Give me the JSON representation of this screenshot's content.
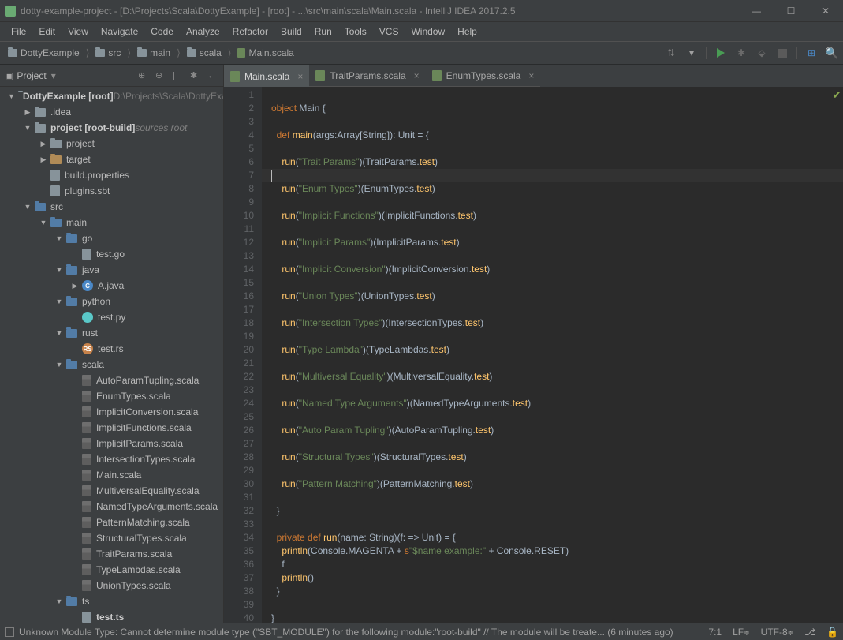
{
  "titlebar": {
    "title": "dotty-example-project - [D:\\Projects\\Scala\\DottyExample] - [root] - ...\\src\\main\\scala\\Main.scala - IntelliJ IDEA 2017.2.5"
  },
  "menu": [
    "File",
    "Edit",
    "View",
    "Navigate",
    "Code",
    "Analyze",
    "Refactor",
    "Build",
    "Run",
    "Tools",
    "VCS",
    "Window",
    "Help"
  ],
  "breadcrumbs": [
    {
      "icon": "folder",
      "label": "DottyExample"
    },
    {
      "icon": "folder",
      "label": "src"
    },
    {
      "icon": "folder",
      "label": "main"
    },
    {
      "icon": "folder",
      "label": "scala"
    },
    {
      "icon": "file",
      "label": "Main.scala"
    }
  ],
  "sidebar": {
    "title": "Project",
    "tree": [
      {
        "depth": 0,
        "arrow": "▼",
        "icon": "folder",
        "label": "DottyExample [root]",
        "bold": true,
        "suffix": "D:\\Projects\\Scala\\DottyExample",
        "suffixDim": true
      },
      {
        "depth": 1,
        "arrow": "▶",
        "icon": "folder",
        "label": ".idea"
      },
      {
        "depth": 1,
        "arrow": "▼",
        "icon": "folder",
        "label": "project [root-build]",
        "bold": true,
        "suffix": "sources root",
        "suffixSrc": true
      },
      {
        "depth": 2,
        "arrow": "▶",
        "icon": "folder",
        "label": "project"
      },
      {
        "depth": 2,
        "arrow": "▶",
        "icon": "folder-orange",
        "label": "target"
      },
      {
        "depth": 2,
        "arrow": "",
        "icon": "file",
        "label": "build.properties"
      },
      {
        "depth": 2,
        "arrow": "",
        "icon": "file",
        "label": "plugins.sbt"
      },
      {
        "depth": 1,
        "arrow": "▼",
        "icon": "folder-blue",
        "label": "src"
      },
      {
        "depth": 2,
        "arrow": "▼",
        "icon": "folder-blue",
        "label": "main"
      },
      {
        "depth": 3,
        "arrow": "▼",
        "icon": "folder-blue",
        "label": "go"
      },
      {
        "depth": 4,
        "arrow": "",
        "icon": "file",
        "label": "test.go"
      },
      {
        "depth": 3,
        "arrow": "▼",
        "icon": "folder-blue",
        "label": "java"
      },
      {
        "depth": 4,
        "arrow": "▶",
        "icon": "circ-blue",
        "circText": "C",
        "label": "A.java"
      },
      {
        "depth": 3,
        "arrow": "▼",
        "icon": "folder-blue",
        "label": "python"
      },
      {
        "depth": 4,
        "arrow": "",
        "icon": "circ-cyan",
        "circText": "",
        "label": "test.py"
      },
      {
        "depth": 3,
        "arrow": "▼",
        "icon": "folder-blue",
        "label": "rust"
      },
      {
        "depth": 4,
        "arrow": "",
        "icon": "circ-orange",
        "circText": "RS",
        "label": "test.rs"
      },
      {
        "depth": 3,
        "arrow": "▼",
        "icon": "folder-blue",
        "label": "scala"
      },
      {
        "depth": 4,
        "arrow": "",
        "icon": "file-scala",
        "label": "AutoParamTupling.scala"
      },
      {
        "depth": 4,
        "arrow": "",
        "icon": "file-scala",
        "label": "EnumTypes.scala"
      },
      {
        "depth": 4,
        "arrow": "",
        "icon": "file-scala",
        "label": "ImplicitConversion.scala"
      },
      {
        "depth": 4,
        "arrow": "",
        "icon": "file-scala",
        "label": "ImplicitFunctions.scala"
      },
      {
        "depth": 4,
        "arrow": "",
        "icon": "file-scala",
        "label": "ImplicitParams.scala"
      },
      {
        "depth": 4,
        "arrow": "",
        "icon": "file-scala",
        "label": "IntersectionTypes.scala"
      },
      {
        "depth": 4,
        "arrow": "",
        "icon": "file-scala",
        "label": "Main.scala"
      },
      {
        "depth": 4,
        "arrow": "",
        "icon": "file-scala",
        "label": "MultiversalEquality.scala"
      },
      {
        "depth": 4,
        "arrow": "",
        "icon": "file-scala",
        "label": "NamedTypeArguments.scala"
      },
      {
        "depth": 4,
        "arrow": "",
        "icon": "file-scala",
        "label": "PatternMatching.scala"
      },
      {
        "depth": 4,
        "arrow": "",
        "icon": "file-scala",
        "label": "StructuralTypes.scala"
      },
      {
        "depth": 4,
        "arrow": "",
        "icon": "file-scala",
        "label": "TraitParams.scala"
      },
      {
        "depth": 4,
        "arrow": "",
        "icon": "file-scala",
        "label": "TypeLambdas.scala"
      },
      {
        "depth": 4,
        "arrow": "",
        "icon": "file-scala",
        "label": "UnionTypes.scala"
      },
      {
        "depth": 3,
        "arrow": "▼",
        "icon": "folder-blue",
        "label": "ts"
      },
      {
        "depth": 4,
        "arrow": "",
        "icon": "file",
        "label": "test.ts",
        "bold": true
      }
    ]
  },
  "tabs": [
    {
      "label": "Main.scala",
      "active": true
    },
    {
      "label": "TraitParams.scala",
      "active": false
    },
    {
      "label": "EnumTypes.scala",
      "active": false
    }
  ],
  "code": {
    "lines": [
      "",
      "object Main {",
      "",
      "  def main(args:Array[String]): Unit = {",
      "",
      "    run(\"Trait Params\")(TraitParams.test)",
      "",
      "    run(\"Enum Types\")(EnumTypes.test)",
      "",
      "    run(\"Implicit Functions\")(ImplicitFunctions.test)",
      "",
      "    run(\"Implicit Params\")(ImplicitParams.test)",
      "",
      "    run(\"Implicit Conversion\")(ImplicitConversion.test)",
      "",
      "    run(\"Union Types\")(UnionTypes.test)",
      "",
      "    run(\"Intersection Types\")(IntersectionTypes.test)",
      "",
      "    run(\"Type Lambda\")(TypeLambdas.test)",
      "",
      "    run(\"Multiversal Equality\")(MultiversalEquality.test)",
      "",
      "    run(\"Named Type Arguments\")(NamedTypeArguments.test)",
      "",
      "    run(\"Auto Param Tupling\")(AutoParamTupling.test)",
      "",
      "    run(\"Structural Types\")(StructuralTypes.test)",
      "",
      "    run(\"Pattern Matching\")(PatternMatching.test)",
      "",
      "  }",
      "",
      "  private def run(name: String)(f: => Unit) = {",
      "    println(Console.MAGENTA + s\"$name example:\" + Console.RESET)",
      "    f",
      "    println()",
      "  }",
      "",
      "}"
    ],
    "highlightLine": 7,
    "lineCount": 40
  },
  "statusbar": {
    "message": "Unknown Module Type: Cannot determine module type (\"SBT_MODULE\") for the following module:\"root-build\" // The module will be treate... (6 minutes ago)",
    "position": "7:1",
    "lineSep": "LF",
    "encoding": "UTF-8"
  }
}
